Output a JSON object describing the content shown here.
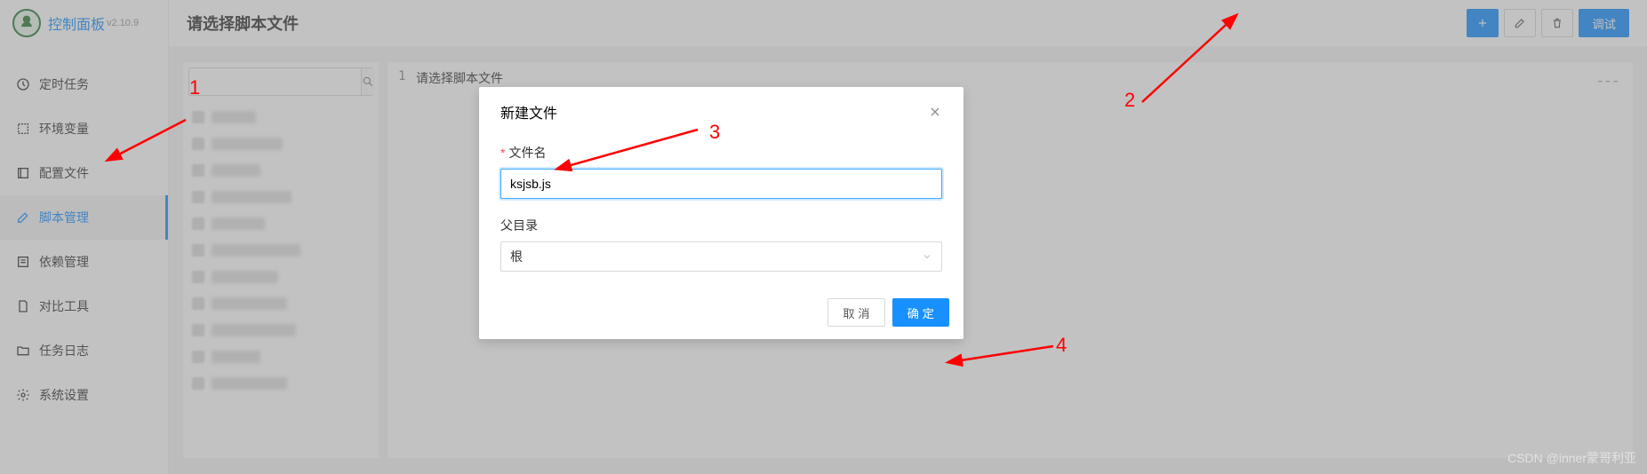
{
  "app": {
    "title": "控制面板",
    "version": "v2.10.9"
  },
  "sidebar": {
    "items": [
      {
        "label": "定时任务"
      },
      {
        "label": "环境变量"
      },
      {
        "label": "配置文件"
      },
      {
        "label": "脚本管理"
      },
      {
        "label": "依赖管理"
      },
      {
        "label": "对比工具"
      },
      {
        "label": "任务日志"
      },
      {
        "label": "系统设置"
      }
    ]
  },
  "topbar": {
    "title": "请选择脚本文件",
    "debug_label": "调试"
  },
  "editor": {
    "line_number": "1",
    "content": "请选择脚本文件"
  },
  "modal": {
    "title": "新建文件",
    "filename_label": "文件名",
    "filename_value": "ksjsb.js",
    "parent_label": "父目录",
    "parent_value": "根",
    "cancel_label": "取 消",
    "confirm_label": "确 定"
  },
  "annotations": {
    "n1": "1",
    "n2": "2",
    "n3": "3",
    "n4": "4"
  },
  "watermark": "CSDN @inner蒙哥利亚"
}
